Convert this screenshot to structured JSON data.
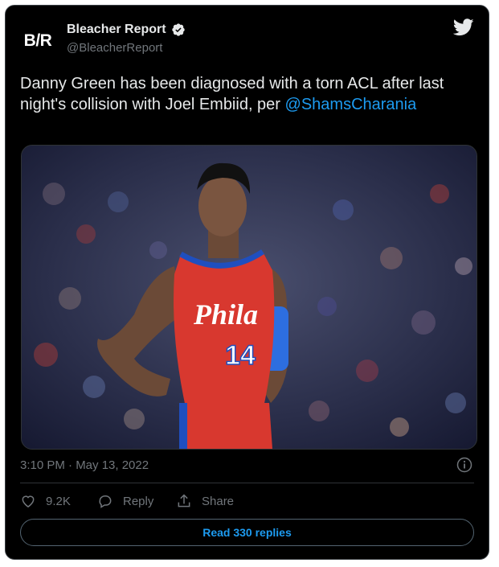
{
  "author": {
    "name": "Bleacher Report",
    "handle": "@BleacherReport",
    "avatar_text": "B/R",
    "verified_icon": "verified-badge-icon"
  },
  "tweet": {
    "text_line": "Danny Green has been diagnosed with a torn ACL after last night's collision with Joel Embiid, per ",
    "mention": "@ShamsCharania",
    "media": {
      "jersey_text": "Phila",
      "jersey_number": "14"
    },
    "timestamp": "3:10 PM · May 13, 2022"
  },
  "actions": {
    "like_count": "9.2K",
    "reply_label": "Reply",
    "share_label": "Share"
  },
  "read_replies_label": "Read 330 replies",
  "colors": {
    "background": "#000000",
    "text": "#e7e9ea",
    "muted": "#71767b",
    "link": "#1d9bf0"
  }
}
